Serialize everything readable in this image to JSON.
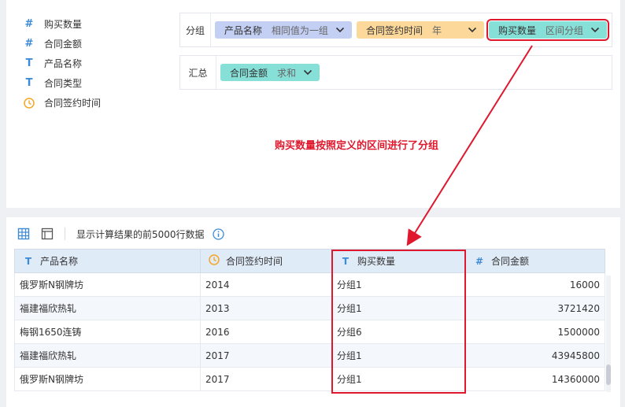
{
  "fields": [
    {
      "icon": "hash-icon",
      "glyph": "#",
      "label": "购买数量"
    },
    {
      "icon": "hash-icon",
      "glyph": "#",
      "label": "合同金额"
    },
    {
      "icon": "text-type-icon",
      "glyph": "T",
      "label": "产品名称"
    },
    {
      "icon": "text-type-icon",
      "glyph": "T",
      "label": "合同类型"
    },
    {
      "icon": "clock-icon",
      "glyph": "",
      "label": "合同签约时间"
    }
  ],
  "groupZone": {
    "label": "分组",
    "chips": [
      {
        "name": "产品名称",
        "mode": "相同值为一组",
        "color": "#c3cff3"
      },
      {
        "name": "合同签约时间",
        "mode": "年",
        "color": "#fcd89a"
      },
      {
        "name": "购买数量",
        "mode": "区间分组",
        "color": "#86e0d8"
      }
    ]
  },
  "summaryZone": {
    "label": "汇总",
    "chips": [
      {
        "name": "合同金额",
        "mode": "求和",
        "color": "#86e0d8"
      }
    ]
  },
  "annotation": "购买数量按照定义的区间进行了分组",
  "toolbar": {
    "text": "显示计算结果的前5000行数据"
  },
  "table": {
    "headers": [
      {
        "icon": "T",
        "label": "产品名称"
      },
      {
        "icon": "clock",
        "label": "合同签约时间"
      },
      {
        "icon": "T",
        "label": "购买数量"
      },
      {
        "icon": "#",
        "label": "合同金额"
      }
    ],
    "rows": [
      [
        "俄罗斯N钢牌坊",
        "2014",
        "分组1",
        "16000"
      ],
      [
        "福建福欣热轧",
        "2013",
        "分组1",
        "3721420"
      ],
      [
        "梅钢1650连铸",
        "2016",
        "分组6",
        "1500000"
      ],
      [
        "福建福欣热轧",
        "2017",
        "分组1",
        "43945800"
      ],
      [
        "俄罗斯N钢牌坊",
        "2017",
        "分组1",
        "14360000"
      ]
    ]
  },
  "colors": {
    "accent": "#3d8bd6",
    "highlight": "#e0182d",
    "clock": "#f5a623"
  }
}
